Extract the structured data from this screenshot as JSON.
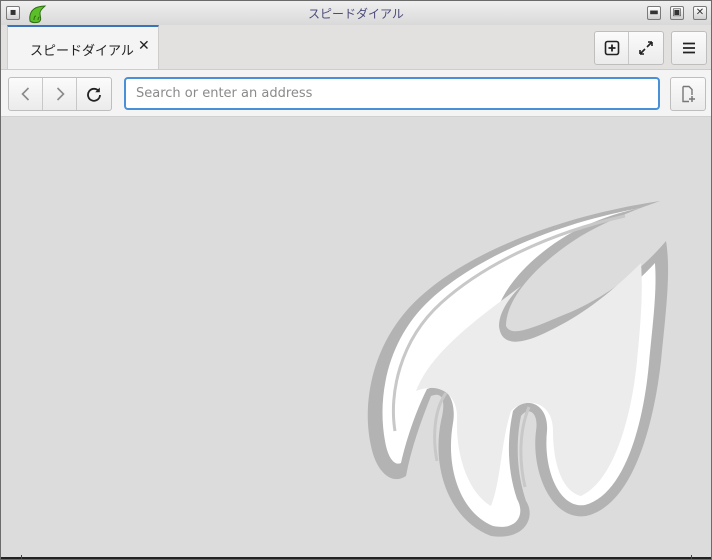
{
  "window": {
    "title": "スピードダイアル",
    "app_icon": "midori-paw-icon",
    "controls": [
      "minimize-icon",
      "maximize-icon",
      "close-icon"
    ]
  },
  "tabs": [
    {
      "label": "スピードダイアル",
      "active": true,
      "close_glyph": "✕"
    }
  ],
  "toolbar": {
    "new_tab_icon": "plus-square-icon",
    "fullscreen_icon": "expand-arrows-icon",
    "menu_icon": "hamburger-menu-icon"
  },
  "navigation": {
    "back_icon": "chevron-left-icon",
    "forward_icon": "chevron-right-icon",
    "reload_icon": "reload-icon",
    "address": {
      "value": "",
      "placeholder": "Search or enter an address"
    },
    "bookmark_icon": "add-bookmark-icon"
  },
  "speed_dial": {
    "watermark": "midori-logo"
  },
  "colors": {
    "accent": "#4a90d9",
    "tab_indicator": "#3b73b9",
    "content_background": "#dcdcdc",
    "watermark_stroke": "#b3b3b3"
  }
}
